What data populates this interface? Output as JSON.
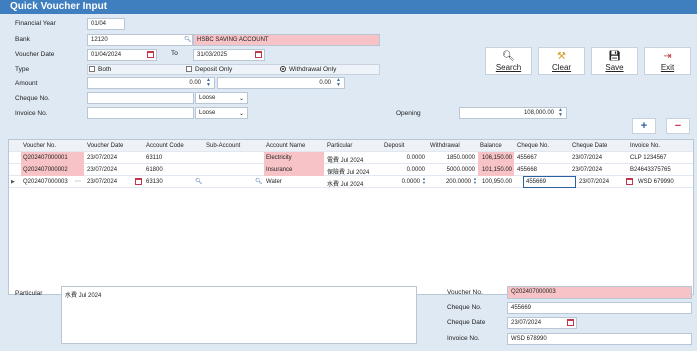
{
  "window": {
    "title": "Quick Voucher Input"
  },
  "form": {
    "financial_year_label": "Financial Year",
    "financial_year": "01/04",
    "bank_label": "Bank",
    "bank_code": "12120",
    "bank_name": "HSBC SAVING ACCOUNT",
    "voucher_date_label": "Voucher Date",
    "date_from": "01/04/2024",
    "to_label": "To",
    "date_to": "31/03/2025",
    "type_label": "Type",
    "type_options": [
      "Both",
      "Deposit Only",
      "Withdrawal Only"
    ],
    "type_selected": "Withdrawal Only",
    "amount_label": "Amount",
    "amount_from": "0.00",
    "amount_to": "0.00",
    "cheque_no_label": "Cheque No.",
    "cheque_no_value": "",
    "cheque_match": "Loose",
    "invoice_no_label": "Invoice No.",
    "invoice_no_value": "",
    "invoice_match": "Loose",
    "opening_label": "Opening",
    "opening_value": "108,000.00"
  },
  "toolbar": {
    "search_label": "Search",
    "clear_label": "Clear",
    "save_label": "Save",
    "exit_label": "Exit",
    "add_label": "+",
    "remove_label": "−"
  },
  "grid": {
    "columns": [
      "Voucher No.",
      "Voucher Date",
      "Account Code",
      "Sub-Account",
      "Account Name",
      "Particular",
      "Deposit",
      "Withdrawal",
      "Balance",
      "Cheque No.",
      "Cheque Date",
      "Invoice No."
    ],
    "rows": [
      [
        "Q202407000001",
        "23/07/2024",
        "63110",
        "",
        "Electricity",
        "電費 Jul 2024",
        "0.0000",
        "1850.0000",
        "106,150.00",
        "455667",
        "23/07/2024",
        "CLP 1234567"
      ],
      [
        "Q202407000002",
        "23/07/2024",
        "61800",
        "",
        "Insurance",
        "保險費 Jul 2024",
        "0.0000",
        "5000.0000",
        "101,150.00",
        "455668",
        "23/07/2024",
        "B24643375765"
      ],
      [
        "Q202407000003",
        "23/07/2024",
        "63130",
        "",
        "Water",
        "水費 Jul 2024",
        "0.0000",
        "200.0000",
        "100,950.00",
        "455669",
        "23/07/2024",
        "WSD 679990"
      ]
    ]
  },
  "detail": {
    "particular_label": "Particular",
    "particular_value": "水費 Jul 2024",
    "voucher_no_label": "Voucher No.",
    "voucher_no_value": "Q202407000003",
    "cheque_no_label": "Cheque No.",
    "cheque_no_value": "455669",
    "cheque_date_label": "Cheque Date",
    "cheque_date_value": "23/07/2024",
    "invoice_no_label": "Invoice No.",
    "invoice_no_value": "WSD 678990"
  },
  "colors": {
    "title_bar": "#3f7fc0",
    "highlight": "#f7c3c6",
    "panel": "#dfe9f4"
  },
  "icons": [
    "search-icon",
    "calendar-icon",
    "broom-icon",
    "floppy-disk-icon",
    "exit-door-icon",
    "spin-arrows-icon",
    "dropdown-arrow-icon"
  ]
}
